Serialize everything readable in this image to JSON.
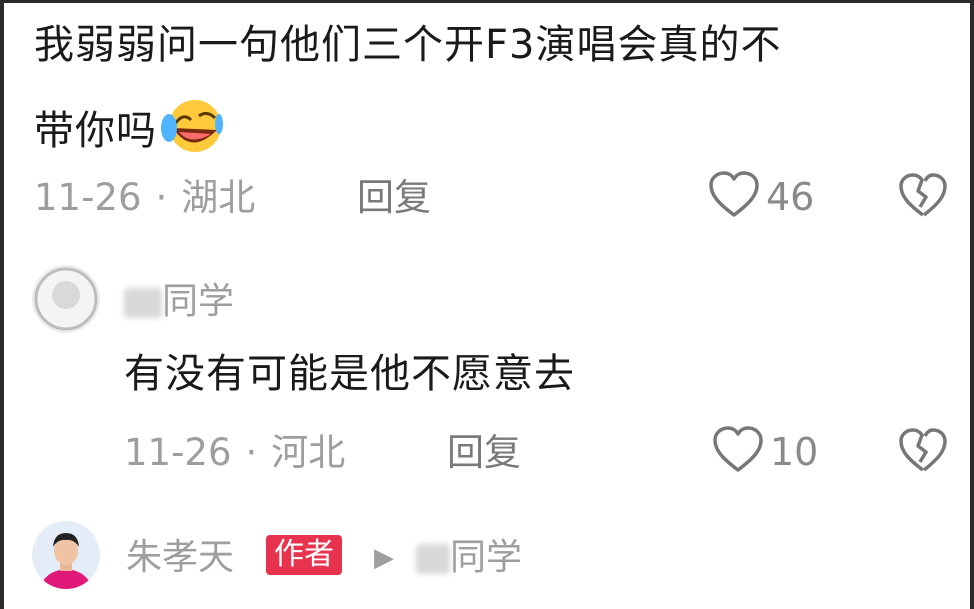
{
  "comments": [
    {
      "text_line1": "我弱弱问一句他们三个开F3演唱会真的不",
      "text_line2": "带你吗",
      "emoji": "laughing-crying-emoji",
      "date": "11-26",
      "separator": "·",
      "location": "湖北",
      "reply_label": "回复",
      "likes": "46"
    },
    {
      "username": "同学",
      "text": "有没有可能是他不愿意去",
      "date": "11-26",
      "separator": "·",
      "location": "河北",
      "reply_label": "回复",
      "likes": "10"
    },
    {
      "username": "朱孝天",
      "badge": "作者",
      "reply_to_arrow": "▶",
      "reply_to_user": "同学"
    }
  ],
  "colors": {
    "text": "#1a1a1a",
    "meta": "#9e9e9e",
    "badge": "#e8334f"
  },
  "icons": {
    "like": "heart-outline-icon",
    "dislike": "broken-heart-icon"
  }
}
